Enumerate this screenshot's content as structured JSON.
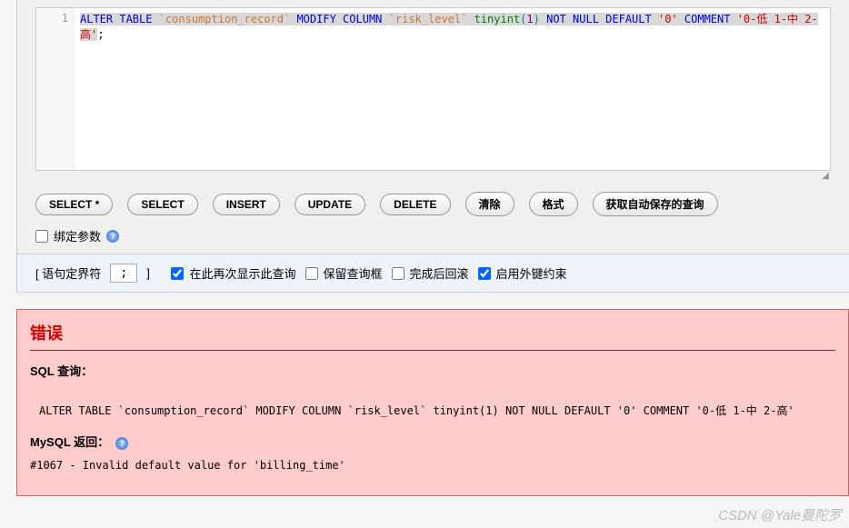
{
  "editor": {
    "line_number": "1",
    "tokens": {
      "alter": "ALTER",
      "table": "TABLE",
      "tablename": "`consumption_record`",
      "modify": "MODIFY",
      "column": "COLUMN",
      "colname": "`risk_level`",
      "tinyint": "tinyint",
      "paren_open": "(",
      "one": "1",
      "paren_close": ")",
      "not": "NOT",
      "null": "NULL",
      "default": "DEFAULT",
      "zero": "'0'",
      "comment": "COMMENT",
      "commentval": "'0-低 1-中 2-高'",
      "semi": ";"
    }
  },
  "buttons": {
    "select_star": "SELECT *",
    "select": "SELECT",
    "insert": "INSERT",
    "update": "UPDATE",
    "delete": "DELETE",
    "clear": "清除",
    "format": "格式",
    "autosave": "获取自动保存的查询"
  },
  "bind_params": "绑定参数",
  "options": {
    "delimiter_label_open": "[ 语句定界符",
    "delimiter_value": ";",
    "delimiter_label_close": "]",
    "show_again": "在此再次显示此查询",
    "keep_box": "保留查询框",
    "rollback": "完成后回滚",
    "fk": "启用外键约束"
  },
  "error": {
    "title": "错误",
    "sql_label": "SQL 查询：",
    "sql_text": "ALTER TABLE `consumption_record` MODIFY COLUMN `risk_level` tinyint(1) NOT NULL DEFAULT '0' COMMENT '0-低 1-中 2-高'",
    "mysql_label": "MySQL 返回：",
    "message": "#1067 - Invalid default value for 'billing_time'"
  },
  "watermark": "CSDN @Yale曼陀罗"
}
